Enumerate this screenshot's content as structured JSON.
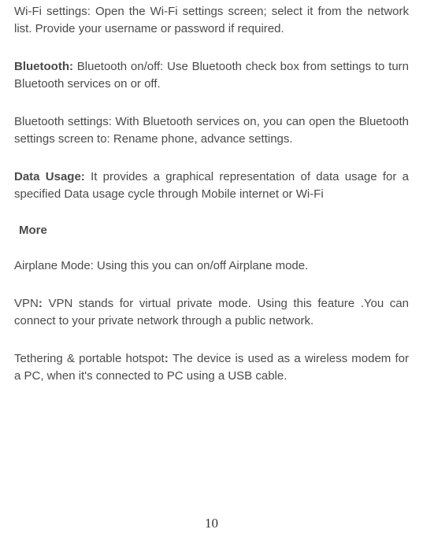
{
  "paragraphs": {
    "wifi_settings": "Wi-Fi settings: Open the Wi-Fi settings screen; select it from the network list. Provide your username or password if required.",
    "bluetooth_lead": "Bluetooth: ",
    "bluetooth_body": "Bluetooth on/off: Use Bluetooth check box from settings to turn Bluetooth services on or off.",
    "bluetooth_settings": "Bluetooth settings: With Bluetooth services on, you can open the Bluetooth settings screen to: Rename phone, advance settings.",
    "data_usage_lead": "Data Usage: ",
    "data_usage_body": "It provides a graphical representation of data usage for a specified Data usage cycle through Mobile internet or Wi-Fi",
    "more_heading": "More",
    "airplane": "Airplane Mode: Using this you can on/off Airplane mode.",
    "vpn_prefix": "VPN",
    "vpn_colon": ": ",
    "vpn_body": "VPN stands for virtual private mode. Using this feature .You can connect to your private network through a public network.",
    "tether_prefix": "Tethering & portable hotspot",
    "tether_colon": ": ",
    "tether_body": "The device is used as a wireless modem for a PC, when it's connected to PC using a USB cable."
  },
  "page_number": "10"
}
